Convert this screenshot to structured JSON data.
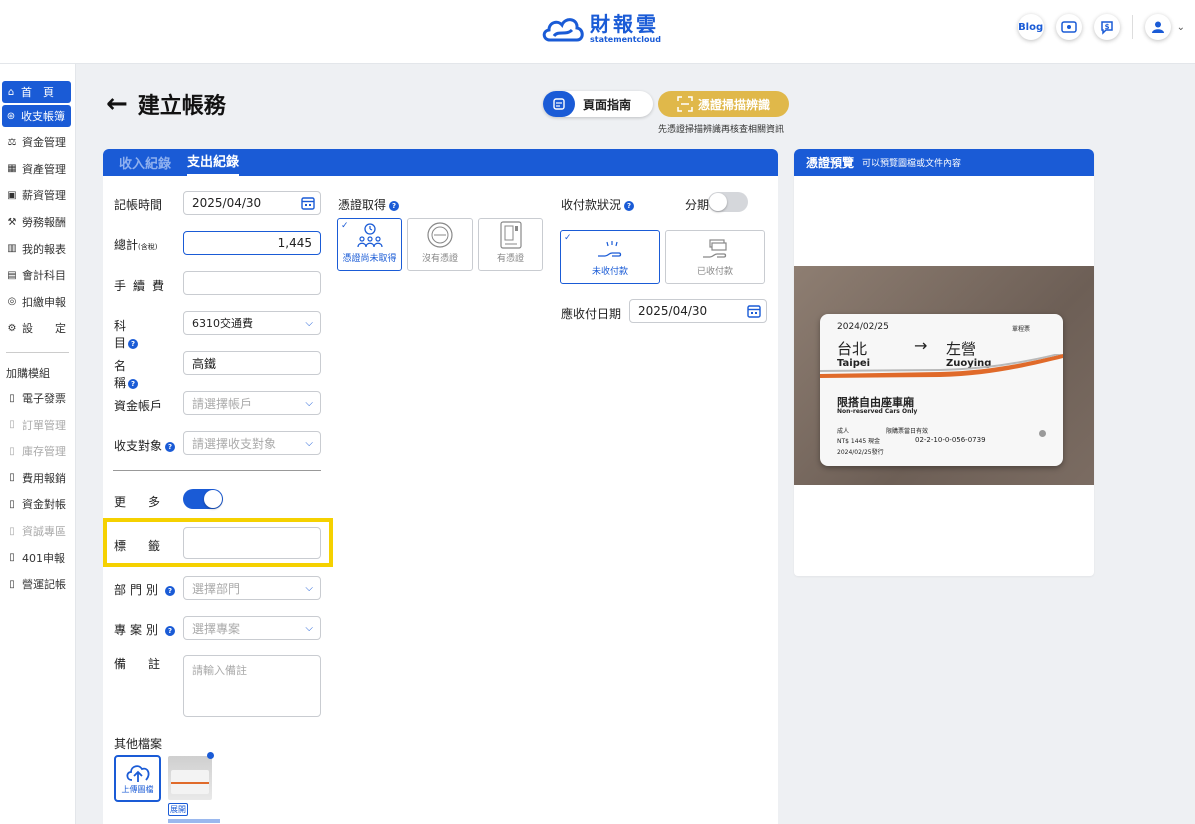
{
  "app": {
    "logo_cn": "財報雲",
    "logo_en": "statementcloud",
    "blog_label": "Blog",
    "brand_color": "#1a5bd6",
    "accent_color": "#e0b84a"
  },
  "sidebar": {
    "items": [
      {
        "label": "首　頁",
        "icon": "home-icon"
      },
      {
        "label": "收支帳簿",
        "icon": "ledger-icon"
      },
      {
        "label": "資金管理",
        "icon": "fund-icon"
      },
      {
        "label": "資產管理",
        "icon": "asset-icon"
      },
      {
        "label": "薪資管理",
        "icon": "payroll-icon"
      },
      {
        "label": "勞務報酬",
        "icon": "labor-icon"
      },
      {
        "label": "我的報表",
        "icon": "report-icon"
      },
      {
        "label": "會計科目",
        "icon": "account-icon"
      },
      {
        "label": "扣繳申報",
        "icon": "withholding-icon"
      },
      {
        "label": "設　　定",
        "icon": "settings-icon"
      }
    ],
    "addon_group": "加購模組",
    "addons": [
      {
        "label": "電子發票",
        "disabled": false
      },
      {
        "label": "訂單管理",
        "disabled": true
      },
      {
        "label": "庫存管理",
        "disabled": true
      },
      {
        "label": "費用報銷",
        "disabled": false
      },
      {
        "label": "資金對帳",
        "disabled": false
      },
      {
        "label": "資誠專區",
        "disabled": true
      },
      {
        "label": "401申報",
        "disabled": false
      },
      {
        "label": "營運記帳",
        "disabled": false
      }
    ]
  },
  "page": {
    "title": "建立帳務",
    "guide_button": "頁面指南",
    "scan_button": "憑證掃描辨識",
    "scan_note": "先憑證掃描辨識再核查相關資訊"
  },
  "tabs": [
    {
      "label": "收入紀錄",
      "active": false
    },
    {
      "label": "支出紀錄",
      "active": true
    }
  ],
  "form": {
    "date_label": "記帳時間",
    "date_value": "2025/04/30",
    "total_label": "總計",
    "total_suffix": "(含稅)",
    "total_value": "1,445",
    "fee_label": "手續費",
    "subject_label": "科目",
    "subject_value": "6310交通費",
    "name_label": "名稱",
    "name_value": "高鐵",
    "account_label": "資金帳戶",
    "account_placeholder": "請選擇帳戶",
    "counterparty_label": "收支對象",
    "counterparty_placeholder": "請選擇收支對象",
    "more_label": "更多",
    "tag_label": "標籤",
    "dept_label": "部門別",
    "dept_placeholder": "選擇部門",
    "project_label": "專案別",
    "project_placeholder": "選擇專案",
    "note_label": "備註",
    "note_placeholder": "請輸入備註",
    "other_files_label": "其他檔案",
    "upload_label": "上傳圖檔",
    "expand_label": "展開"
  },
  "voucher": {
    "label": "憑證取得",
    "options": [
      "憑證尚未取得",
      "沒有憑證",
      "有憑證"
    ]
  },
  "payment": {
    "label": "收付款狀況",
    "installment_label": "分期",
    "options": [
      "未收付款",
      "已收付款"
    ],
    "due_label": "應收付日期",
    "due_value": "2025/04/30"
  },
  "preview": {
    "title": "憑證預覽",
    "subtitle": "可以預覽圖檔或文件內容",
    "ticket": {
      "date": "2024/02/25",
      "type": "單程票",
      "from_cn": "台北",
      "from_en": "Taipei",
      "to_cn": "左營",
      "to_en": "Zuoying",
      "seat_cn": "限搭自由座車廂",
      "seat_en": "Non-reserved Cars Only",
      "passenger": "成人",
      "validity": "限購票當日有效",
      "fare": "NT$ 1445  現金",
      "code": "02-2-10-0-056-0739",
      "issued": "2024/02/25發行"
    }
  }
}
